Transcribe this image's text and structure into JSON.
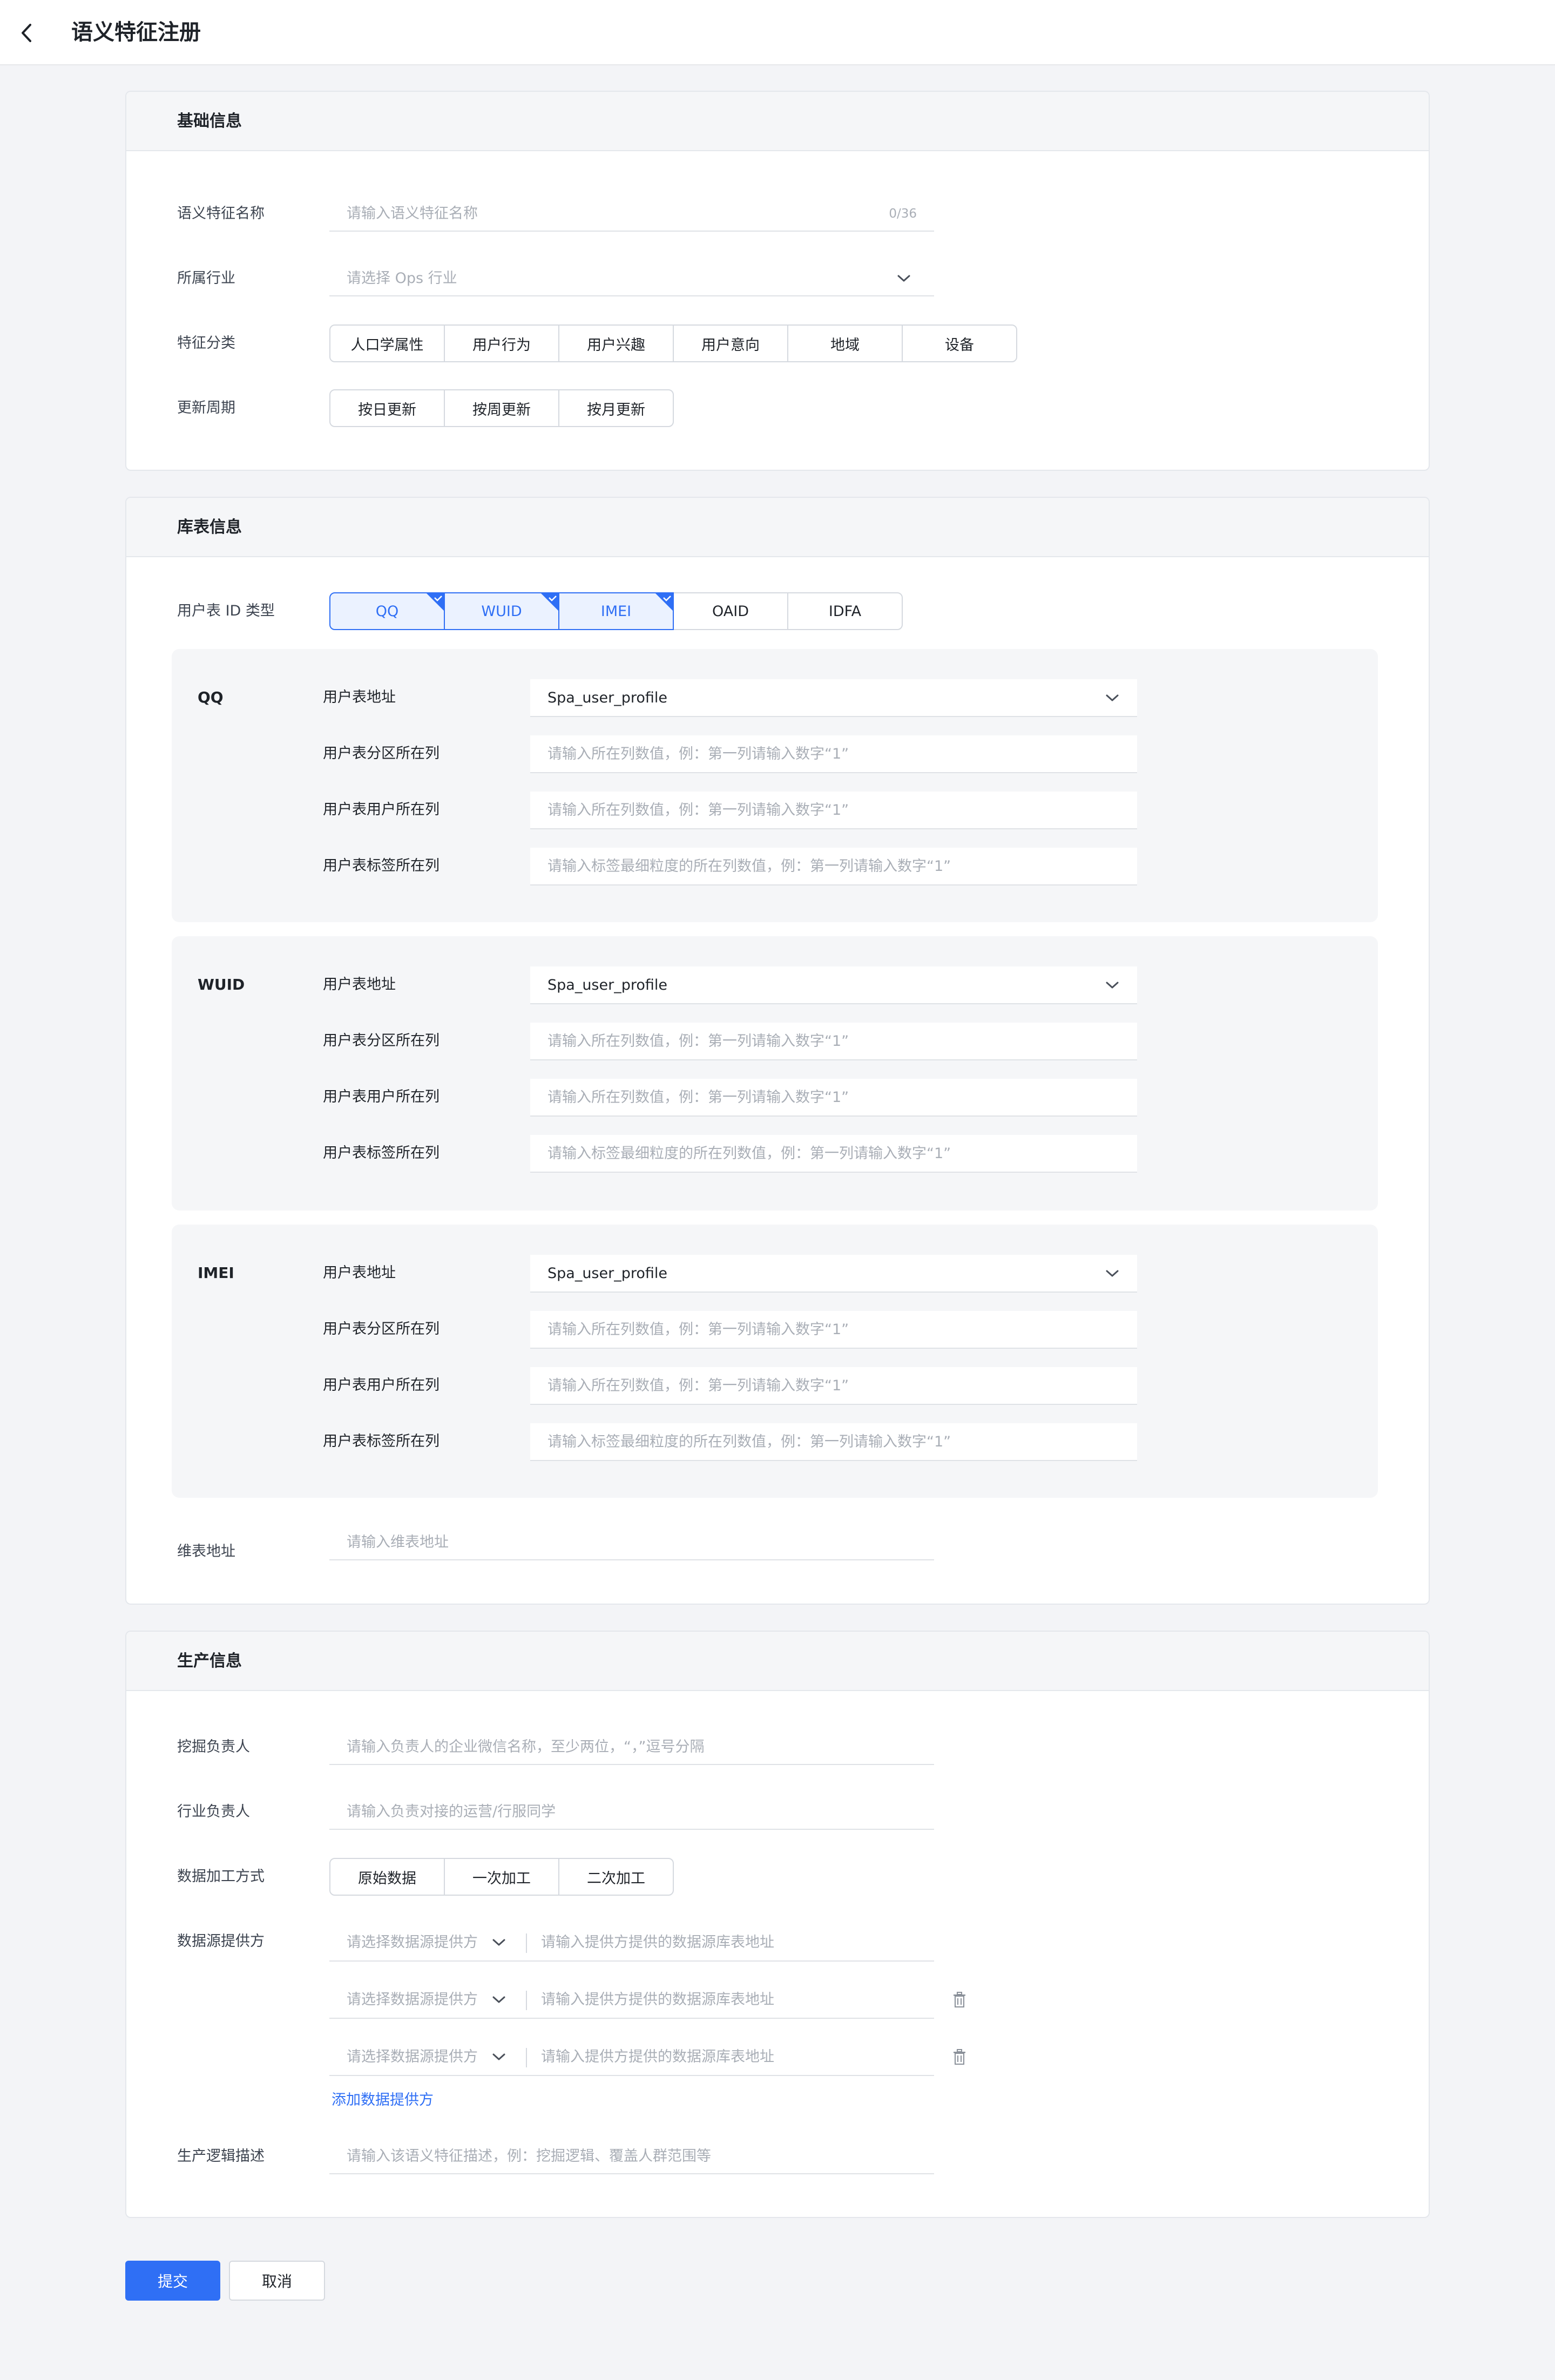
{
  "header": {
    "title": "语义特征注册",
    "back_icon": "chevron-left-icon"
  },
  "basic": {
    "title": "基础信息",
    "name_label": "语义特征名称",
    "name_placeholder": "请输入语义特征名称",
    "name_counter": "0/36",
    "industry_label": "所属行业",
    "industry_placeholder": "请选择 Ops 行业",
    "category_label": "特征分类",
    "categories": [
      "人口学属性",
      "用户行为",
      "用户兴趣",
      "用户意向",
      "地域",
      "设备"
    ],
    "cycle_label": "更新周期",
    "cycles": [
      "按日更新",
      "按周更新",
      "按月更新"
    ]
  },
  "storage": {
    "title": "库表信息",
    "idtype_label": "用户表 ID 类型",
    "id_types": [
      {
        "label": "QQ",
        "selected": true
      },
      {
        "label": "WUID",
        "selected": true
      },
      {
        "label": "IMEI",
        "selected": true
      },
      {
        "label": "OAID",
        "selected": false
      },
      {
        "label": "IDFA",
        "selected": false
      }
    ],
    "panels": [
      {
        "id_type": "QQ",
        "address_label": "用户表地址",
        "address_value": "Spa_user_profile",
        "partition_label": "用户表分区所在列",
        "partition_placeholder": "请输入所在列数值，例：第一列请输入数字“1”",
        "user_col_label": "用户表用户所在列",
        "user_col_placeholder": "请输入所在列数值，例：第一列请输入数字“1”",
        "tag_col_label": "用户表标签所在列",
        "tag_col_placeholder": "请输入标签最细粒度的所在列数值，例：第一列请输入数字“1”"
      },
      {
        "id_type": "WUID",
        "address_label": "用户表地址",
        "address_value": "Spa_user_profile",
        "partition_label": "用户表分区所在列",
        "partition_placeholder": "请输入所在列数值，例：第一列请输入数字“1”",
        "user_col_label": "用户表用户所在列",
        "user_col_placeholder": "请输入所在列数值，例：第一列请输入数字“1”",
        "tag_col_label": "用户表标签所在列",
        "tag_col_placeholder": "请输入标签最细粒度的所在列数值，例：第一列请输入数字“1”"
      },
      {
        "id_type": "IMEI",
        "address_label": "用户表地址",
        "address_value": "Spa_user_profile",
        "partition_label": "用户表分区所在列",
        "partition_placeholder": "请输入所在列数值，例：第一列请输入数字“1”",
        "user_col_label": "用户表用户所在列",
        "user_col_placeholder": "请输入所在列数值，例：第一列请输入数字“1”",
        "tag_col_label": "用户表标签所在列",
        "tag_col_placeholder": "请输入标签最细粒度的所在列数值，例：第一列请输入数字“1”"
      }
    ],
    "dim_label": "维表地址",
    "dim_placeholder": "请输入维表地址"
  },
  "production": {
    "title": "生产信息",
    "miner_label": "挖掘负责人",
    "miner_placeholder": "请输入负责人的企业微信名称，至少两位，“，”逗号分隔",
    "industry_owner_label": "行业负责人",
    "industry_owner_placeholder": "请输入负责对接的运营/行服同学",
    "process_label": "数据加工方式",
    "processes": [
      "原始数据",
      "一次加工",
      "二次加工"
    ],
    "provider_label": "数据源提供方",
    "providers": [
      {
        "select_placeholder": "请选择数据源提供方",
        "address_placeholder": "请输入提供方提供的数据源库表地址"
      },
      {
        "select_placeholder": "请选择数据源提供方",
        "address_placeholder": "请输入提供方提供的数据源库表地址"
      },
      {
        "select_placeholder": "请选择数据源提供方",
        "address_placeholder": "请输入提供方提供的数据源库表地址"
      }
    ],
    "add_provider": "添加数据提供方",
    "logic_label": "生产逻辑描述",
    "logic_placeholder": "请输入该语义特征描述，例：挖掘逻辑、覆盖人群范围等"
  },
  "actions": {
    "submit": "提交",
    "cancel": "取消"
  },
  "colors": {
    "accent": "#2f6ff5",
    "page_bg": "#f3f4f7",
    "panel_bg": "#f5f6f8"
  }
}
